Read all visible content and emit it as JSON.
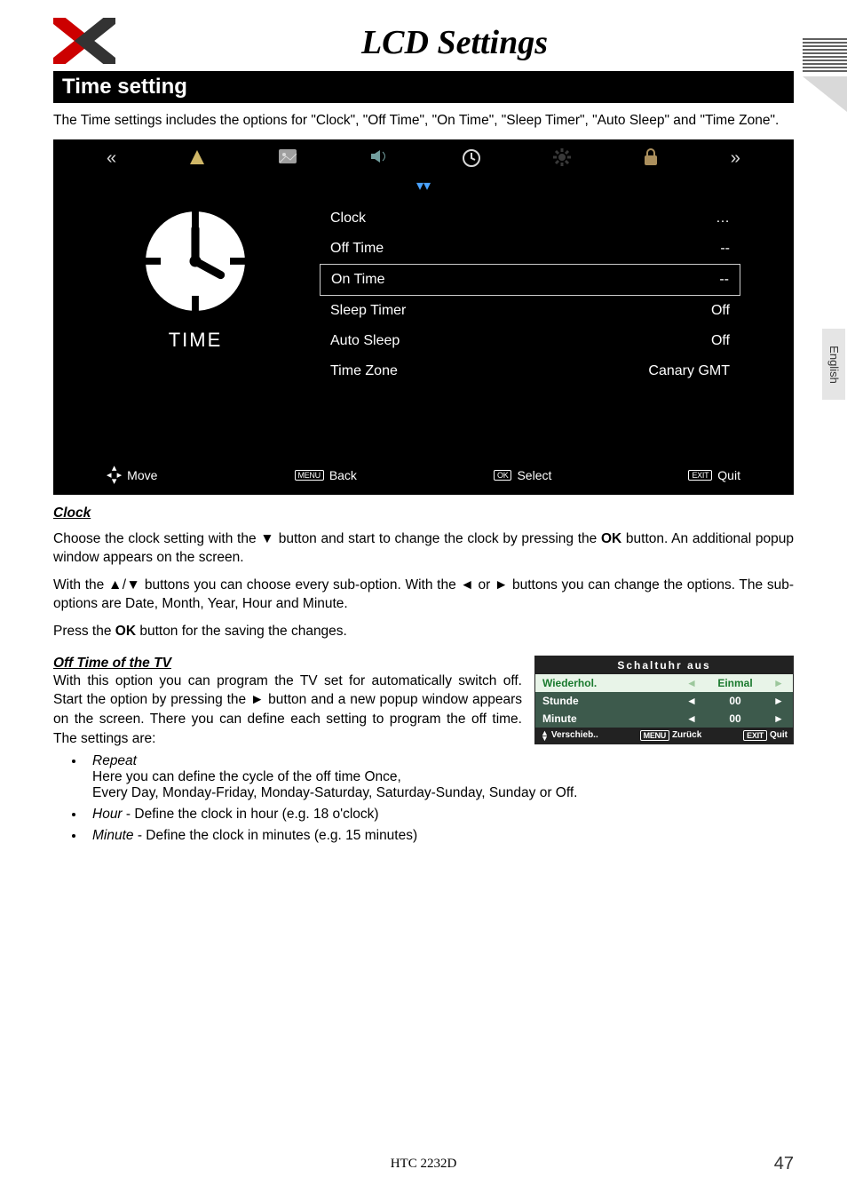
{
  "title": "LCD Settings",
  "section": "Time setting",
  "intro": "The Time settings includes the options for \"Clock\", \"Off Time\", \"On Time\", \"Sleep Timer\", \"Auto Sleep\" and \"Time Zone\".",
  "osd1": {
    "time_label": "TIME",
    "rows": [
      {
        "label": "Clock",
        "value": "…"
      },
      {
        "label": "Off Time",
        "value": "--"
      },
      {
        "label": "On Time",
        "value": "--"
      },
      {
        "label": "Sleep Timer",
        "value": "Off"
      },
      {
        "label": "Auto Sleep",
        "value": "Off"
      },
      {
        "label": "Time Zone",
        "value": "Canary GMT"
      }
    ],
    "selected_index": 2,
    "footer": {
      "move": "Move",
      "back_key": "MENU",
      "back": "Back",
      "select_key": "OK",
      "select": "Select",
      "quit_key": "EXIT",
      "quit": "Quit"
    }
  },
  "clock": {
    "heading": "Clock",
    "p1_a": "Choose the clock setting with the ▼ button and start to change the clock by pressing the ",
    "p1_b": "OK",
    "p1_c": " button. An additional popup window appears on the screen.",
    "p2": "With the ▲/▼ buttons you can choose every sub-option. With the ◄ or ► buttons you can change the options. The sub-options are Date, Month, Year, Hour and Minute.",
    "p3_a": "Press the ",
    "p3_b": "OK",
    "p3_c": " button for the saving the changes."
  },
  "offtime": {
    "heading": "Off Time of the TV",
    "p1": "With this option you can program the TV set for automatically switch off. Start the option by pressing the ► button and a new popup window appears on the screen. There you can define each setting to program the off time. The settings are:",
    "bullets": {
      "b1_head": "Repeat",
      "b1_l1": "Here you can define the cycle of the off time Once,",
      "b1_l2": "Every Day, Monday-Friday, Monday-Saturday, Saturday-Sunday, Sunday or Off.",
      "b2_head": "Hour",
      "b2_text": "  - Define the clock in hour (e.g. 18 o'clock)",
      "b3_head": "Minute",
      "b3_text": " - Define the clock in minutes (e.g. 15 minutes)"
    }
  },
  "osd2": {
    "title": "Schaltuhr aus",
    "rows": [
      {
        "label": "Wiederhol.",
        "value": "Einmal",
        "green": true
      },
      {
        "label": "Stunde",
        "value": "00",
        "green": false
      },
      {
        "label": "Minute",
        "value": "00",
        "green": false
      }
    ],
    "footer": {
      "verschieb": "Verschieb..",
      "zuruck_key": "MENU",
      "zuruck": "Zurück",
      "quit_key": "EXIT",
      "quit": "Quit"
    }
  },
  "side_tab": "English",
  "footer": {
    "model": "HTC 2232D",
    "page": "47"
  }
}
